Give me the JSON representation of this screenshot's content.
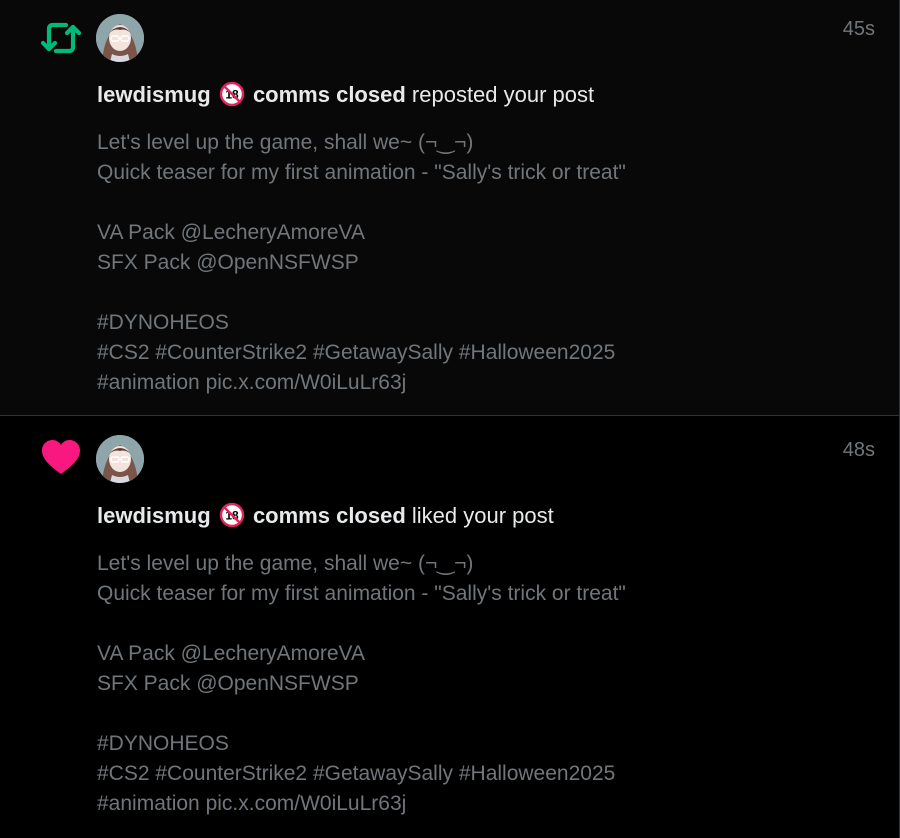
{
  "notifications": [
    {
      "type_icon": "retweet-icon",
      "accent": "#00ba7c",
      "time": "45s",
      "user": "lewdismug",
      "user_suffix": "comms closed",
      "action": "reposted your post",
      "post_lines": [
        "Let's level up the game, shall we~ (¬‿¬)",
        "Quick teaser for my first animation - \"Sally's trick or treat\"",
        "",
        "VA Pack @LecheryAmoreVA",
        "SFX Pack @OpenNSFWSP",
        "",
        "#DYNOHEOS",
        "#CS2 #CounterStrike2 #GetawaySally #Halloween2025",
        "#animation pic.x.com/W0iLuLr63j"
      ]
    },
    {
      "type_icon": "heart-icon",
      "accent": "#f91880",
      "time": "48s",
      "user": "lewdismug",
      "user_suffix": "comms closed",
      "action": "liked your post",
      "post_lines": [
        "Let's level up the game, shall we~ (¬‿¬)",
        "Quick teaser for my first animation - \"Sally's trick or treat\"",
        "",
        "VA Pack @LecheryAmoreVA",
        "SFX Pack @OpenNSFWSP",
        "",
        "#DYNOHEOS",
        "#CS2 #CounterStrike2 #GetawaySally #Halloween2025",
        "#animation pic.x.com/W0iLuLr63j"
      ]
    }
  ],
  "badge": {
    "icon": "no-under-18-icon",
    "text": "18",
    "color": "#e0245e"
  }
}
